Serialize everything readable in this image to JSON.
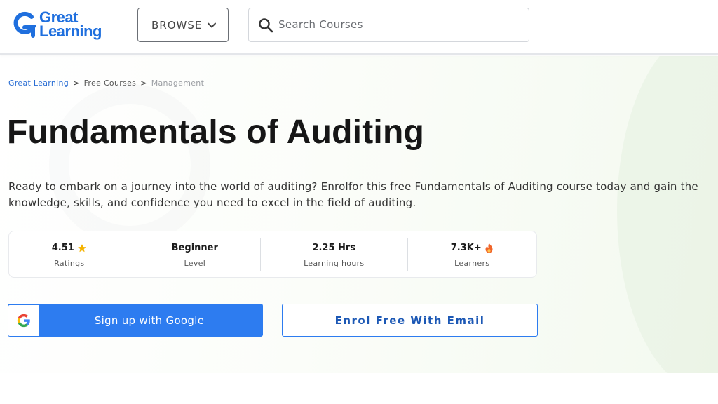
{
  "header": {
    "logo_line1": "Great",
    "logo_line2": "Learning",
    "browse_label": "BROWSE",
    "search_placeholder": "Search Courses"
  },
  "breadcrumb": {
    "items": [
      "Great Learning",
      "Free Courses",
      "Management"
    ],
    "separator": ">"
  },
  "course": {
    "title": "Fundamentals of Auditing",
    "description": "Ready to embark on a journey into the world of auditing? Enrolfor this free Fundamentals of Auditing course today and gain the knowledge, skills, and confidence you need to excel in the field of auditing."
  },
  "stats": [
    {
      "value": "4.51",
      "label": "Ratings",
      "icon": "star-icon"
    },
    {
      "value": "Beginner",
      "label": "Level",
      "icon": ""
    },
    {
      "value": "2.25 Hrs",
      "label": "Learning hours",
      "icon": ""
    },
    {
      "value": "7.3K+",
      "label": "Learners",
      "icon": "flame-icon"
    }
  ],
  "actions": {
    "google_label": "Sign up with Google",
    "email_label": "Enrol Free With Email"
  },
  "colors": {
    "brand_blue": "#1f6fde",
    "button_blue": "#2d7cf0",
    "star_yellow": "#f5b301",
    "flame_orange": "#f0652a"
  }
}
